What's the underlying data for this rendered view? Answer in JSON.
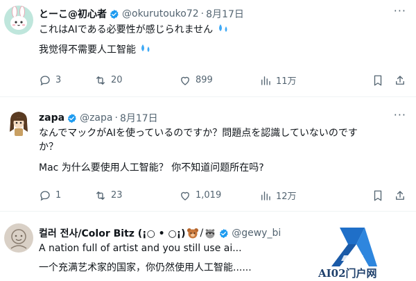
{
  "tweets": [
    {
      "name": "とーこ@初心者",
      "handle": "@okurutouko72",
      "date": "8月17日",
      "line1": "これはAIである必要性が感じられません",
      "line2": "我觉得不需要人工智能",
      "counts": {
        "replies": "3",
        "reposts": "20",
        "likes": "899",
        "views": "11万"
      }
    },
    {
      "name": "zapa",
      "handle": "@zapa",
      "date": "8月17日",
      "line1": "なんでマックがAIを使っているのですか？問題点を認識していないのです",
      "line2": "か？",
      "line3": "Mac 为什么要使用人工智能？ 你不知道问题所在吗?",
      "counts": {
        "replies": "1",
        "reposts": "23",
        "likes": "1,019",
        "views": "12万"
      }
    },
    {
      "name": "컬러 전사/Color Bitz (¡○ • ○¡)",
      "handle": "@gewy_bi",
      "line1": "A nation full of artist and you still use ai...",
      "line2": "一个充满艺术家的国家，你仍然使用人工智能......"
    }
  ],
  "watermark": {
    "text": "AI02门户网"
  },
  "icons": {
    "reply": "reply-icon",
    "repost": "repost-icon",
    "like": "heart-icon",
    "views": "views-icon",
    "bookmark": "bookmark-icon",
    "share": "share-icon",
    "more": "more-icon",
    "verified": "verified-badge-icon"
  },
  "colors": {
    "text": "#0f1419",
    "muted": "#536471",
    "verified": "#1d9bf0",
    "sweat": "#3fa9f5"
  }
}
